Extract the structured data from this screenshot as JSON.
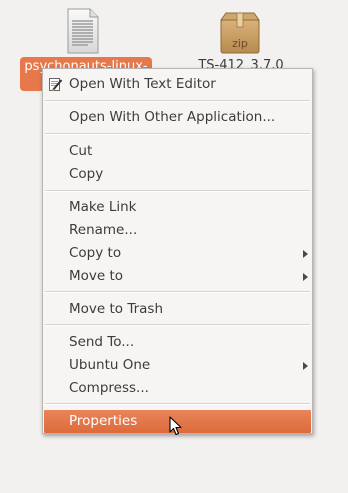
{
  "desktop": {
    "files": [
      {
        "name": "psychonauts-linux-",
        "icon": "text-file-icon",
        "selected": true
      },
      {
        "name": "TS-412_3.7.0",
        "icon": "zip-archive-icon",
        "icon_text": "zip",
        "selected": false
      }
    ]
  },
  "menu": {
    "items": [
      {
        "label": "Open With Text Editor",
        "icon": "text-editor-icon"
      },
      {
        "label": "Open With Other Application..."
      },
      {
        "label": "Cut"
      },
      {
        "label": "Copy"
      },
      {
        "label": "Make Link"
      },
      {
        "label": "Rename..."
      },
      {
        "label": "Copy to",
        "submenu": true
      },
      {
        "label": "Move to",
        "submenu": true
      },
      {
        "label": "Move to Trash"
      },
      {
        "label": "Send To..."
      },
      {
        "label": "Ubuntu One",
        "submenu": true
      },
      {
        "label": "Compress..."
      },
      {
        "label": "Properties",
        "highlighted": true
      }
    ]
  },
  "colors": {
    "selection": "#e6784c",
    "highlight": "#dd6a3b",
    "menu_background": "#f6f5f4",
    "desktop_background": "#f2f1f0"
  }
}
